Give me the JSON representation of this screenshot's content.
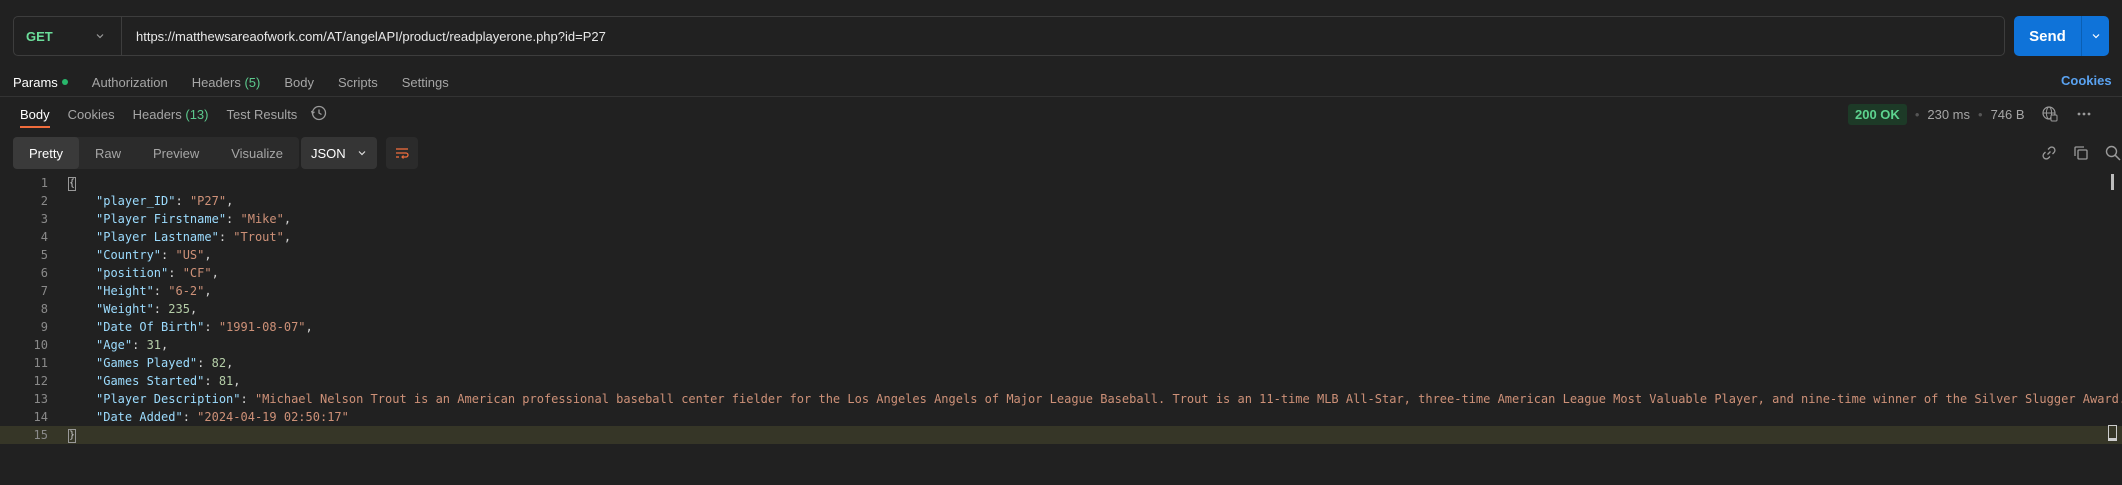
{
  "request": {
    "method": "GET",
    "url": "https://matthewsareaofwork.com/AT/angelAPI/product/readplayerone.php?id=P27",
    "send_label": "Send"
  },
  "request_tabs": [
    {
      "label": "Params",
      "count": "",
      "active": true,
      "dot": true
    },
    {
      "label": "Authorization",
      "count": ""
    },
    {
      "label": "Headers",
      "count": "(5)"
    },
    {
      "label": "Body",
      "count": ""
    },
    {
      "label": "Scripts",
      "count": ""
    },
    {
      "label": "Settings",
      "count": ""
    }
  ],
  "cookies_link": "Cookies",
  "response_tabs": [
    {
      "label": "Body",
      "count": "",
      "active": true
    },
    {
      "label": "Cookies",
      "count": ""
    },
    {
      "label": "Headers",
      "count": "(13)"
    },
    {
      "label": "Test Results",
      "count": ""
    }
  ],
  "status": {
    "code": "200 OK",
    "time": "230 ms",
    "size": "746 B"
  },
  "view_modes": [
    "Pretty",
    "Raw",
    "Preview",
    "Visualize"
  ],
  "format": "JSON",
  "code_lines": [
    {
      "n": "1",
      "type": "open",
      "text": "{"
    },
    {
      "n": "2",
      "key": "\"player_ID\"",
      "val": "\"P27\"",
      "vtype": "str"
    },
    {
      "n": "3",
      "key": "\"Player Firstname\"",
      "val": "\"Mike\"",
      "vtype": "str"
    },
    {
      "n": "4",
      "key": "\"Player Lastname\"",
      "val": "\"Trout\"",
      "vtype": "str"
    },
    {
      "n": "5",
      "key": "\"Country\"",
      "val": "\"US\"",
      "vtype": "str"
    },
    {
      "n": "6",
      "key": "\"position\"",
      "val": "\"CF\"",
      "vtype": "str"
    },
    {
      "n": "7",
      "key": "\"Height\"",
      "val": "\"6-2\"",
      "vtype": "str"
    },
    {
      "n": "8",
      "key": "\"Weight\"",
      "val": "235",
      "vtype": "num"
    },
    {
      "n": "9",
      "key": "\"Date Of Birth\"",
      "val": "\"1991-08-07\"",
      "vtype": "str"
    },
    {
      "n": "10",
      "key": "\"Age\"",
      "val": "31",
      "vtype": "num"
    },
    {
      "n": "11",
      "key": "\"Games Played\"",
      "val": "82",
      "vtype": "num"
    },
    {
      "n": "12",
      "key": "\"Games Started\"",
      "val": "81",
      "vtype": "num"
    },
    {
      "n": "13",
      "key": "\"Player Description\"",
      "val": "\"Michael Nelson Trout is an American professional baseball center fielder for the Los Angeles Angels of Major League Baseball. Trout is an 11-time MLB All-Star, three-time American League Most Valuable Player, and nine-time winner of the Silver Slugger Award.",
      "vtype": "str"
    },
    {
      "n": "14",
      "key": "\"Date Added\"",
      "val": "\"2024-04-19 02:50:17\"",
      "vtype": "str",
      "last": true
    },
    {
      "n": "15",
      "type": "close",
      "text": "}"
    }
  ]
}
